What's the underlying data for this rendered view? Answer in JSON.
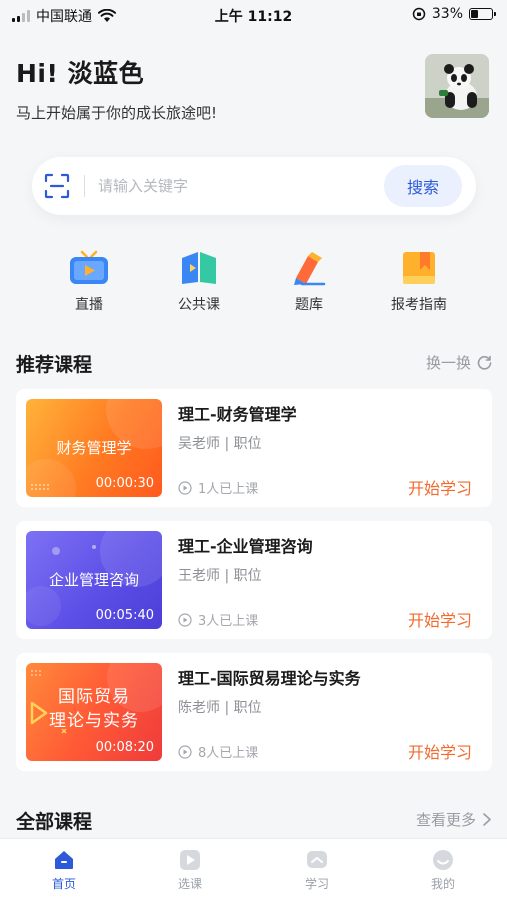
{
  "status_bar": {
    "carrier": "中国联通",
    "time": "上午 11:12",
    "battery": "33%"
  },
  "header": {
    "greeting": "Hi! 淡蓝色",
    "subtitle": "马上开始属于你的成长旅途吧!"
  },
  "search": {
    "placeholder": "请输入关键字",
    "button_label": "搜索"
  },
  "quick_nav": [
    {
      "label": "直播",
      "icon": "tv-icon"
    },
    {
      "label": "公共课",
      "icon": "book-icon"
    },
    {
      "label": "题库",
      "icon": "pencil-icon"
    },
    {
      "label": "报考指南",
      "icon": "bookmark-icon"
    }
  ],
  "recommended": {
    "title": "推荐课程",
    "action": "换一换",
    "courses": [
      {
        "thumb_text": "财务管理学",
        "duration": "00:00:30",
        "title": "理工-财务管理学",
        "teacher": "吴老师 | 职位",
        "learners": "1人已上课",
        "action": "开始学习"
      },
      {
        "thumb_text": "企业管理咨询",
        "duration": "00:05:40",
        "title": "理工-企业管理咨询",
        "teacher": "王老师 | 职位",
        "learners": "3人已上课",
        "action": "开始学习"
      },
      {
        "thumb_text_line1": "国际贸易",
        "thumb_text_line2": "理论与实务",
        "duration": "00:08:20",
        "title": "理工-国际贸易理论与实务",
        "teacher": "陈老师 | 职位",
        "learners": "8人已上课",
        "action": "开始学习"
      }
    ]
  },
  "all_courses": {
    "title": "全部课程",
    "action": "查看更多"
  },
  "tab_bar": [
    {
      "label": "首页",
      "active": true
    },
    {
      "label": "选课",
      "active": false
    },
    {
      "label": "学习",
      "active": false
    },
    {
      "label": "我的",
      "active": false
    }
  ],
  "colors": {
    "accent": "#2d5bd8",
    "start_button": "#f26a2e",
    "background": "#f5f6f8"
  }
}
